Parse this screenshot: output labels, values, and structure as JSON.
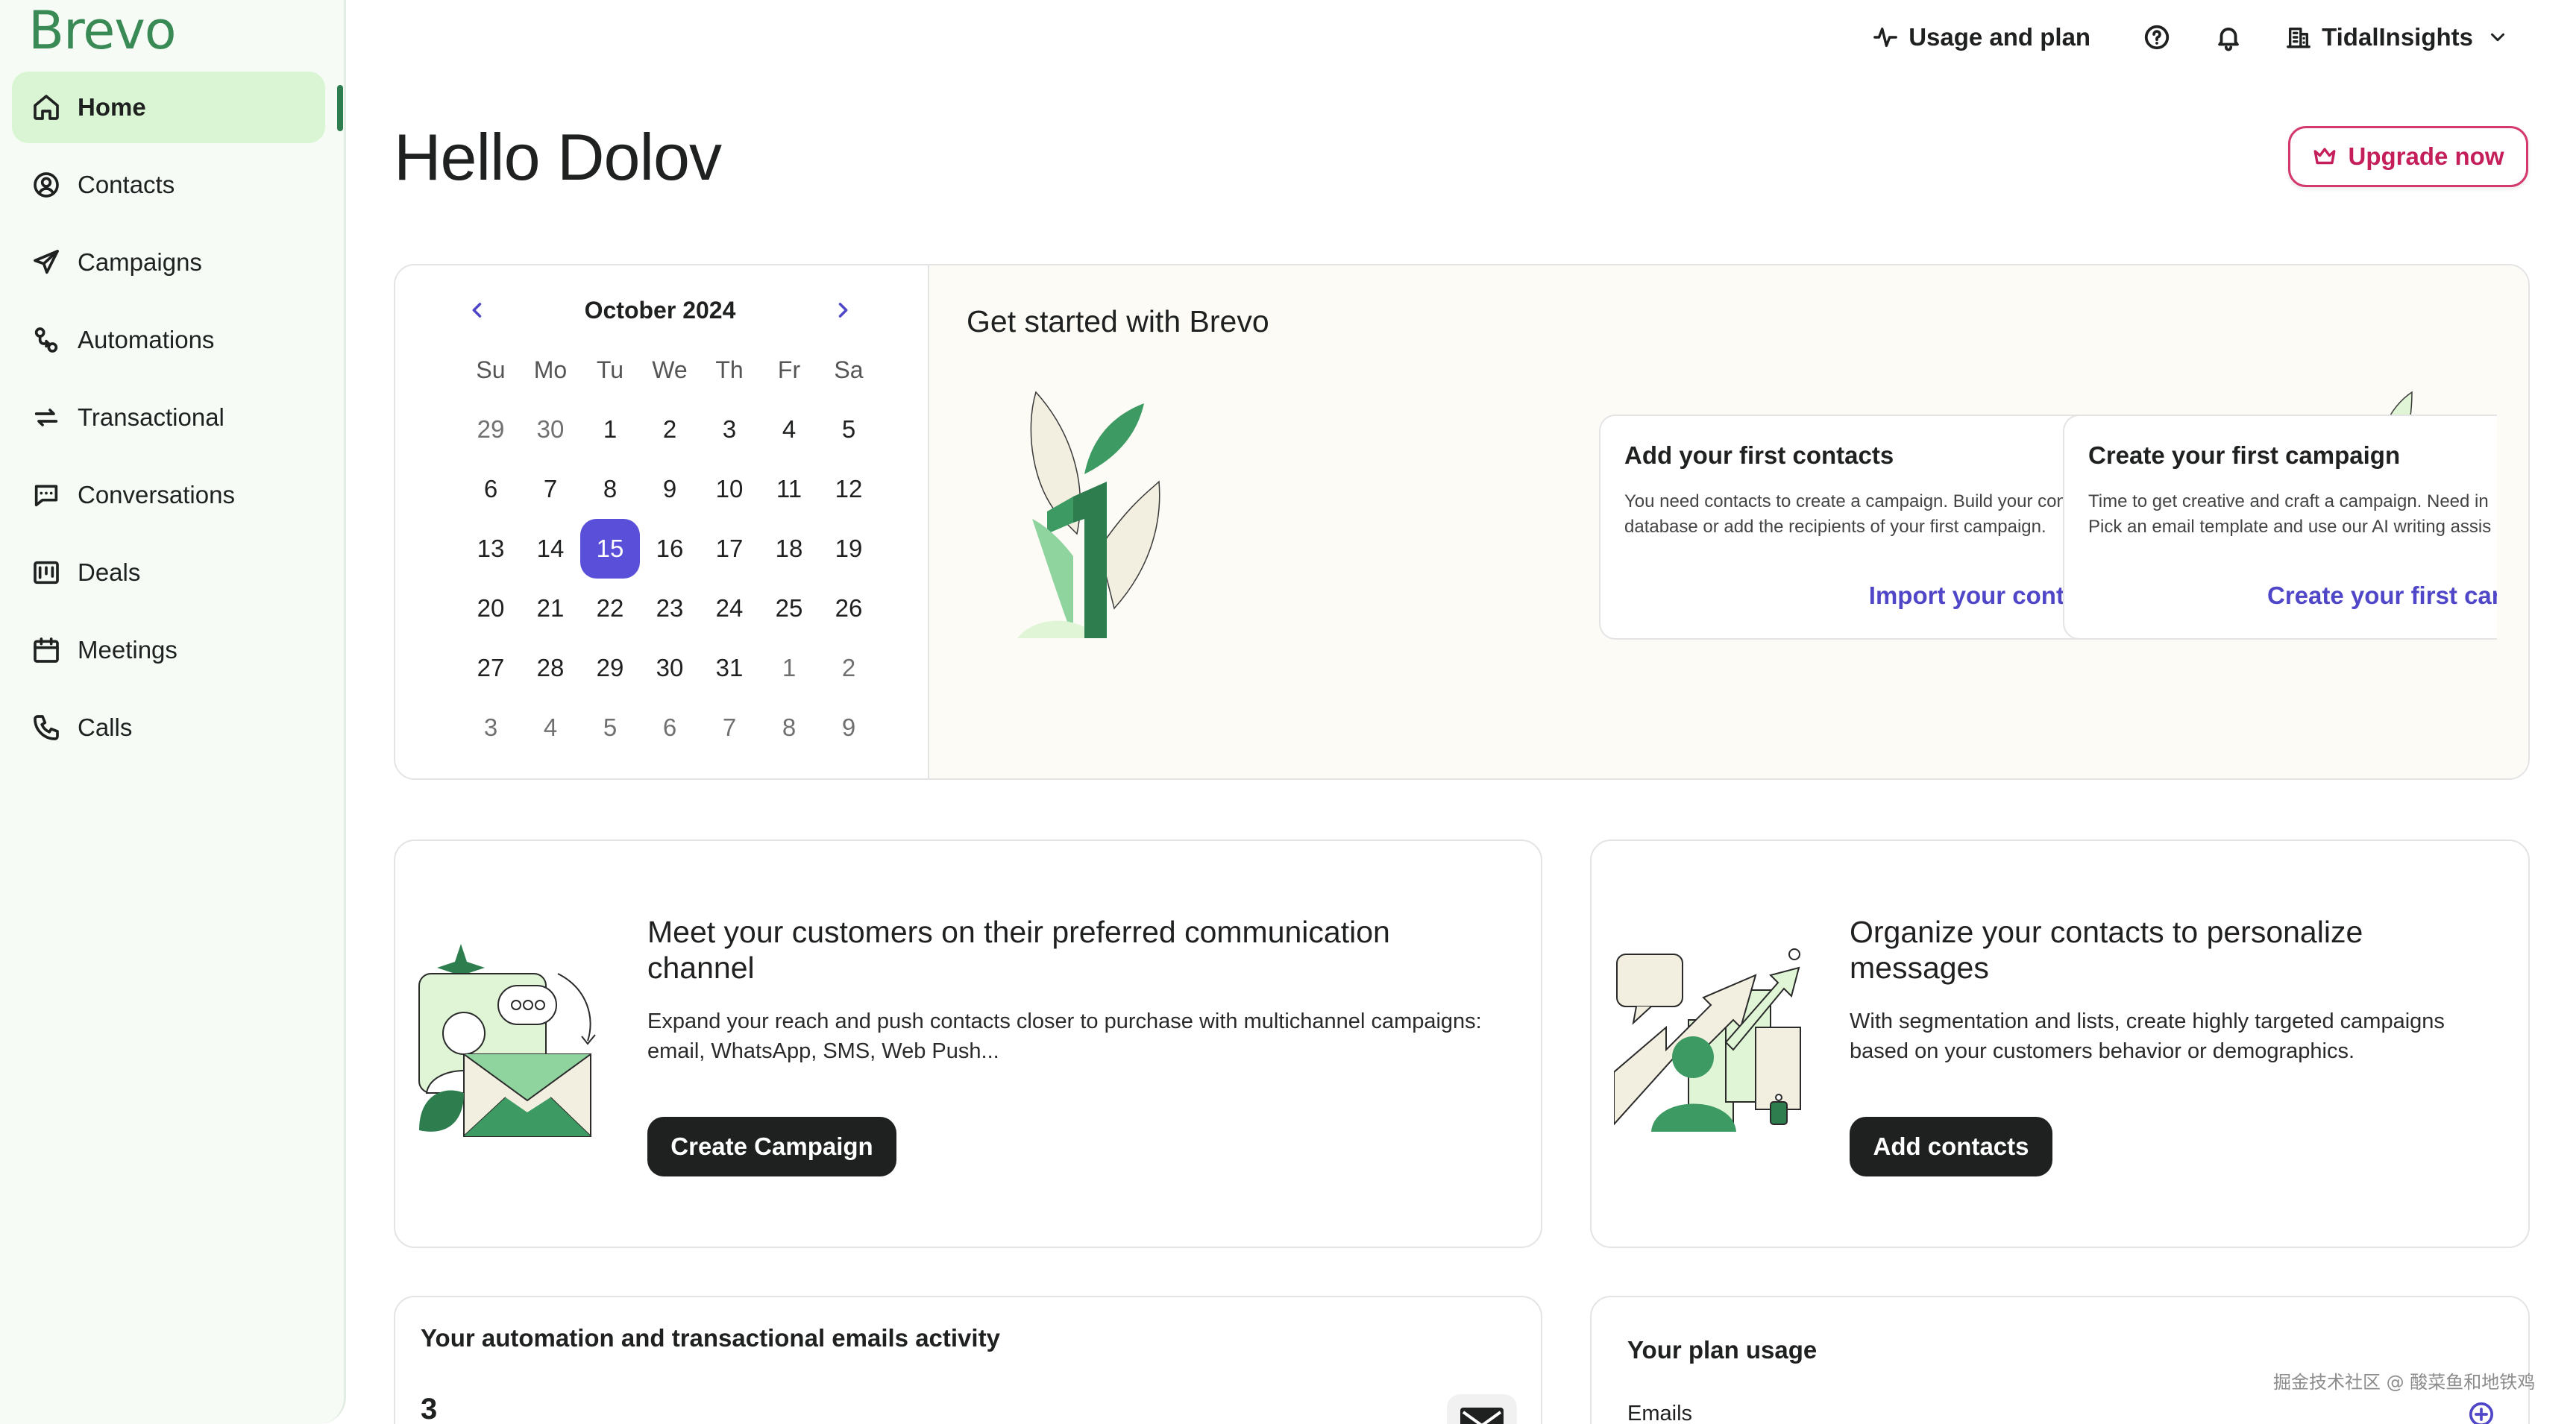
{
  "app": {
    "logo": "Brevo"
  },
  "sidebar": {
    "items": [
      {
        "label": "Home",
        "icon": "home-icon",
        "active": true
      },
      {
        "label": "Contacts",
        "icon": "contacts-icon"
      },
      {
        "label": "Campaigns",
        "icon": "paper-plane-icon"
      },
      {
        "label": "Automations",
        "icon": "automation-icon"
      },
      {
        "label": "Transactional",
        "icon": "repeat-icon"
      },
      {
        "label": "Conversations",
        "icon": "chat-icon"
      },
      {
        "label": "Deals",
        "icon": "kanban-icon"
      },
      {
        "label": "Meetings",
        "icon": "calendar-icon"
      },
      {
        "label": "Calls",
        "icon": "phone-icon"
      }
    ]
  },
  "topbar": {
    "usage_label": "Usage and plan",
    "org_name": "TidalInsights"
  },
  "header": {
    "greeting": "Hello Dolov",
    "upgrade_label": "Upgrade now"
  },
  "calendar": {
    "month_label": "October 2024",
    "weekdays": [
      "Su",
      "Mo",
      "Tu",
      "We",
      "Th",
      "Fr",
      "Sa"
    ],
    "weeks": [
      [
        "29",
        "30",
        "1",
        "2",
        "3",
        "4",
        "5"
      ],
      [
        "6",
        "7",
        "8",
        "9",
        "10",
        "11",
        "12"
      ],
      [
        "13",
        "14",
        "15",
        "16",
        "17",
        "18",
        "19"
      ],
      [
        "20",
        "21",
        "22",
        "23",
        "24",
        "25",
        "26"
      ],
      [
        "27",
        "28",
        "29",
        "30",
        "31",
        "1",
        "2"
      ],
      [
        "3",
        "4",
        "5",
        "6",
        "7",
        "8",
        "9"
      ]
    ],
    "selected_day": "15",
    "accent_color": "#5a4fd8"
  },
  "get_started": {
    "title": "Get started with Brevo",
    "step1": {
      "title": "Add your first contacts",
      "desc_line1": "You need contacts to create a campaign. Build your contact",
      "desc_line2": "database or add the recipients of your first campaign.",
      "link": "Import your contacts"
    },
    "step2": {
      "title": "Create your first campaign",
      "desc_line1": "Time to get creative and craft a campaign. Need in",
      "desc_line2": "Pick an email template and use our AI writing assis",
      "link": "Create your first camp"
    }
  },
  "features": {
    "channel": {
      "title": "Meet your customers on their preferred communication channel",
      "desc": "Expand your reach and push contacts closer to purchase with multichannel campaigns: email, WhatsApp, SMS, Web Push...",
      "button": "Create Campaign"
    },
    "contacts": {
      "title": "Organize your contacts to personalize messages",
      "desc": "With segmentation and lists, create highly targeted campaigns based on your customers behavior or demographics.",
      "button": "Add contacts"
    }
  },
  "activity": {
    "title": "Your automation and transactional emails activity",
    "count": "3"
  },
  "plan_usage": {
    "title": "Your plan usage",
    "row_label": "Emails"
  },
  "watermark": "掘金技术社区 @ 酸菜鱼和地铁鸡",
  "colors": {
    "brand_green": "#2e7d4f",
    "link_purple": "#4f46c8",
    "upgrade_pink": "#c41e5b"
  }
}
